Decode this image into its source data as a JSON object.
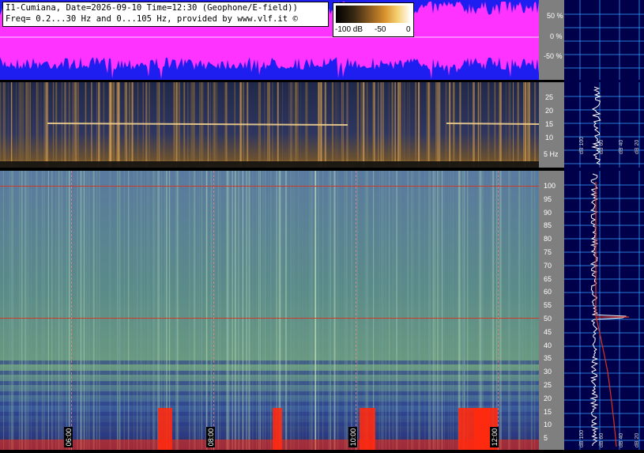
{
  "header": {
    "line1": "I1-Cumiana, Date=2026-09-10 Time=12:30 (Geophone/E-field))",
    "line2": "Freq= 0.2...30 Hz and 0...105 Hz, provided by www.vlf.it ©"
  },
  "colorbar": {
    "left_label": "-100 dB",
    "mid_label": "-50",
    "right_label": "0"
  },
  "wave_axis": {
    "ticks": [
      "50 %",
      "0 %",
      "-50 %"
    ]
  },
  "geo_axis": {
    "ticks": [
      "25",
      "20",
      "15",
      "10",
      "5 Hz"
    ]
  },
  "efield_axis": {
    "ticks": [
      "100",
      "95",
      "90",
      "85",
      "80",
      "75",
      "70",
      "65",
      "60",
      "55",
      "50",
      "45",
      "40",
      "35",
      "30",
      "25",
      "20",
      "15",
      "10",
      "5"
    ]
  },
  "time_labels": [
    "06:00",
    "08:00",
    "10:00",
    "12:00"
  ],
  "side_labels": [
    "dB 100",
    "dB 60",
    "dB 40",
    "dB 20"
  ],
  "colors": {
    "waveform": "#ff33ff",
    "wave_bg": "#1e1ef0",
    "mains_line": "#cc3b2a",
    "burst": "#ff2a10",
    "grid": "#3399ff"
  },
  "icons": [
    "spectrogram-image",
    "waveform-image",
    "profile-trace"
  ]
}
